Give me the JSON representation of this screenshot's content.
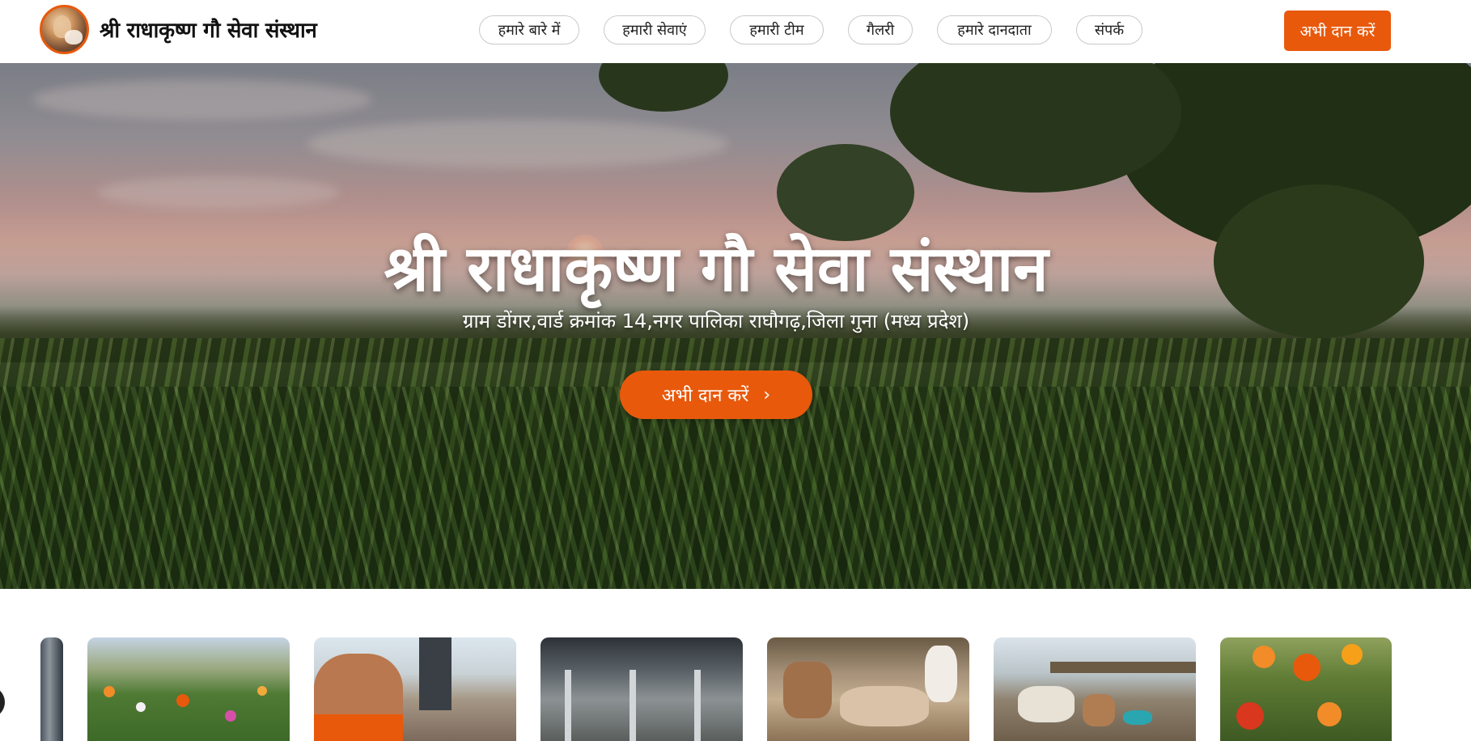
{
  "header": {
    "brand_name": "श्री राधाकृष्ण गौ सेवा संस्थान",
    "nav": [
      {
        "label": "हमारे बारे में"
      },
      {
        "label": "हमारी सेवाएं"
      },
      {
        "label": "हमारी टीम"
      },
      {
        "label": "गैलरी"
      },
      {
        "label": "हमारे दानदाता"
      },
      {
        "label": "संपर्क"
      }
    ],
    "donate_label": "अभी दान करें"
  },
  "hero": {
    "title": "श्री राधाकृष्ण गौ सेवा संस्थान",
    "subtitle": "ग्राम डोंगर,वार्ड क्रमांक 14,नगर पालिका राघौगढ़,जिला गुना (मध्य प्रदेश)",
    "cta_label": "अभी दान करें",
    "cta_icon": "chevron-right-icon"
  },
  "colors": {
    "accent": "#e8590c",
    "text": "#111111",
    "nav_border": "#c9c9c9"
  },
  "gallery": {
    "images": [
      {
        "name": "shed-partial"
      },
      {
        "name": "flower-garden"
      },
      {
        "name": "borewell-man"
      },
      {
        "name": "cow-shed-interior"
      },
      {
        "name": "calves"
      },
      {
        "name": "cows-shelter"
      },
      {
        "name": "marigolds"
      }
    ]
  }
}
